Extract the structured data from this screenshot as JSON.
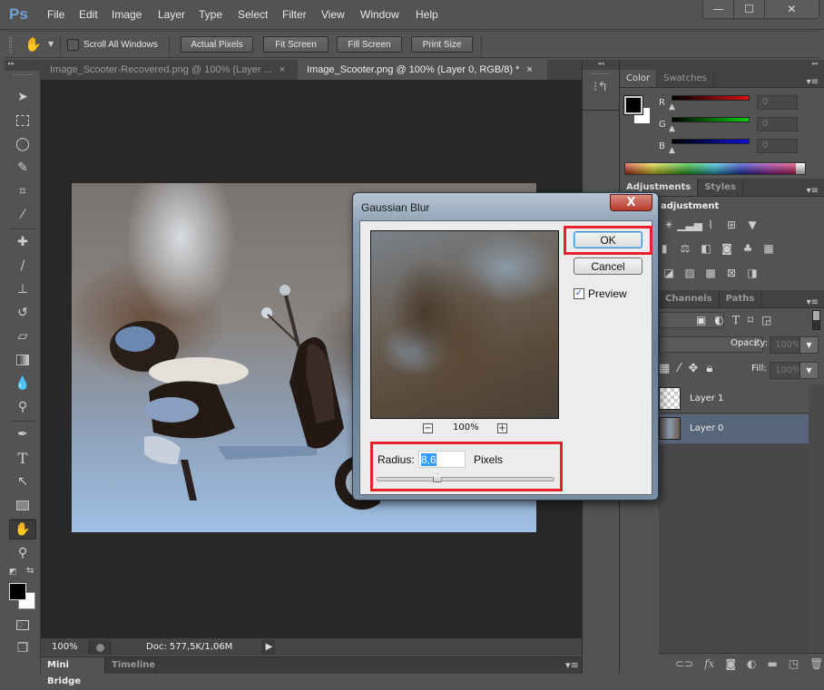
{
  "app": {
    "logo": "Ps"
  },
  "menu": [
    "File",
    "Edit",
    "Image",
    "Layer",
    "Type",
    "Select",
    "Filter",
    "View",
    "Window",
    "Help"
  ],
  "window_controls": {
    "minimize": "—",
    "maximize": "☐",
    "close": "✕"
  },
  "options_bar": {
    "tool_icon": "hand-icon",
    "scroll_all_windows": {
      "label": "Scroll All Windows",
      "checked": false
    },
    "buttons": [
      "Actual Pixels",
      "Fit Screen",
      "Fill Screen",
      "Print Size"
    ]
  },
  "doc_tabs": [
    {
      "title": "Image_Scooter-Recovered.png @ 100% (Layer ...",
      "active": false,
      "close": "×"
    },
    {
      "title": "Image_Scooter.png @ 100% (Layer 0, RGB/8) *",
      "active": true,
      "close": "×"
    }
  ],
  "status": {
    "zoom": "100%",
    "doc": "Doc: 577,5K/1,06M",
    "arrow": "▶"
  },
  "bottom_tabs": [
    {
      "label": "Mini Bridge",
      "active": true
    },
    {
      "label": "Timeline",
      "active": false
    }
  ],
  "color_panel": {
    "tabs": [
      {
        "label": "Color",
        "active": true
      },
      {
        "label": "Swatches",
        "active": false
      }
    ],
    "channels": [
      {
        "label": "R",
        "value": "0",
        "color": "#e01010"
      },
      {
        "label": "G",
        "value": "0",
        "color": "#10d010"
      },
      {
        "label": "B",
        "value": "0",
        "color": "#1010e0"
      }
    ],
    "foreground": "#000000",
    "background": "#ffffff"
  },
  "adjustments_panel": {
    "tabs": [
      {
        "label": "Adjustments",
        "active": true
      },
      {
        "label": "Styles",
        "active": false
      }
    ],
    "heading": "adjustment",
    "rows": [
      [
        "brightness-icon",
        "levels-icon",
        "curves-icon",
        "exposure-icon",
        "vibrance-icon"
      ],
      [
        "hue-sat-icon",
        "color-balance-icon",
        "black-white-icon",
        "photo-filter-icon",
        "channel-mixer-icon",
        "color-lookup-icon"
      ],
      [
        "invert-icon",
        "posterize-icon",
        "threshold-icon",
        "selective-color-icon",
        "gradient-map-icon"
      ]
    ]
  },
  "layers_panel": {
    "tabs": [
      {
        "label": "Channels",
        "active": false
      },
      {
        "label": "Paths",
        "active": false
      }
    ],
    "opacity_label": "Opacity:",
    "opacity": "100%",
    "fill_label": "Fill:",
    "fill": "100%",
    "layers": [
      {
        "name": "Layer 1",
        "selected": false
      },
      {
        "name": "Layer 0",
        "selected": true
      }
    ]
  },
  "dialog": {
    "title": "Gaussian Blur",
    "close": "X",
    "ok": "OK",
    "cancel": "Cancel",
    "preview_label": "Preview",
    "preview_checked": true,
    "zoom": "100%",
    "zoom_out": "−",
    "zoom_in": "+",
    "radius_label": "Radius:",
    "radius_value": "8,6",
    "radius_unit": "Pixels",
    "radius_slider_fraction": 0.34,
    "highlight_color": "#e8202c"
  }
}
